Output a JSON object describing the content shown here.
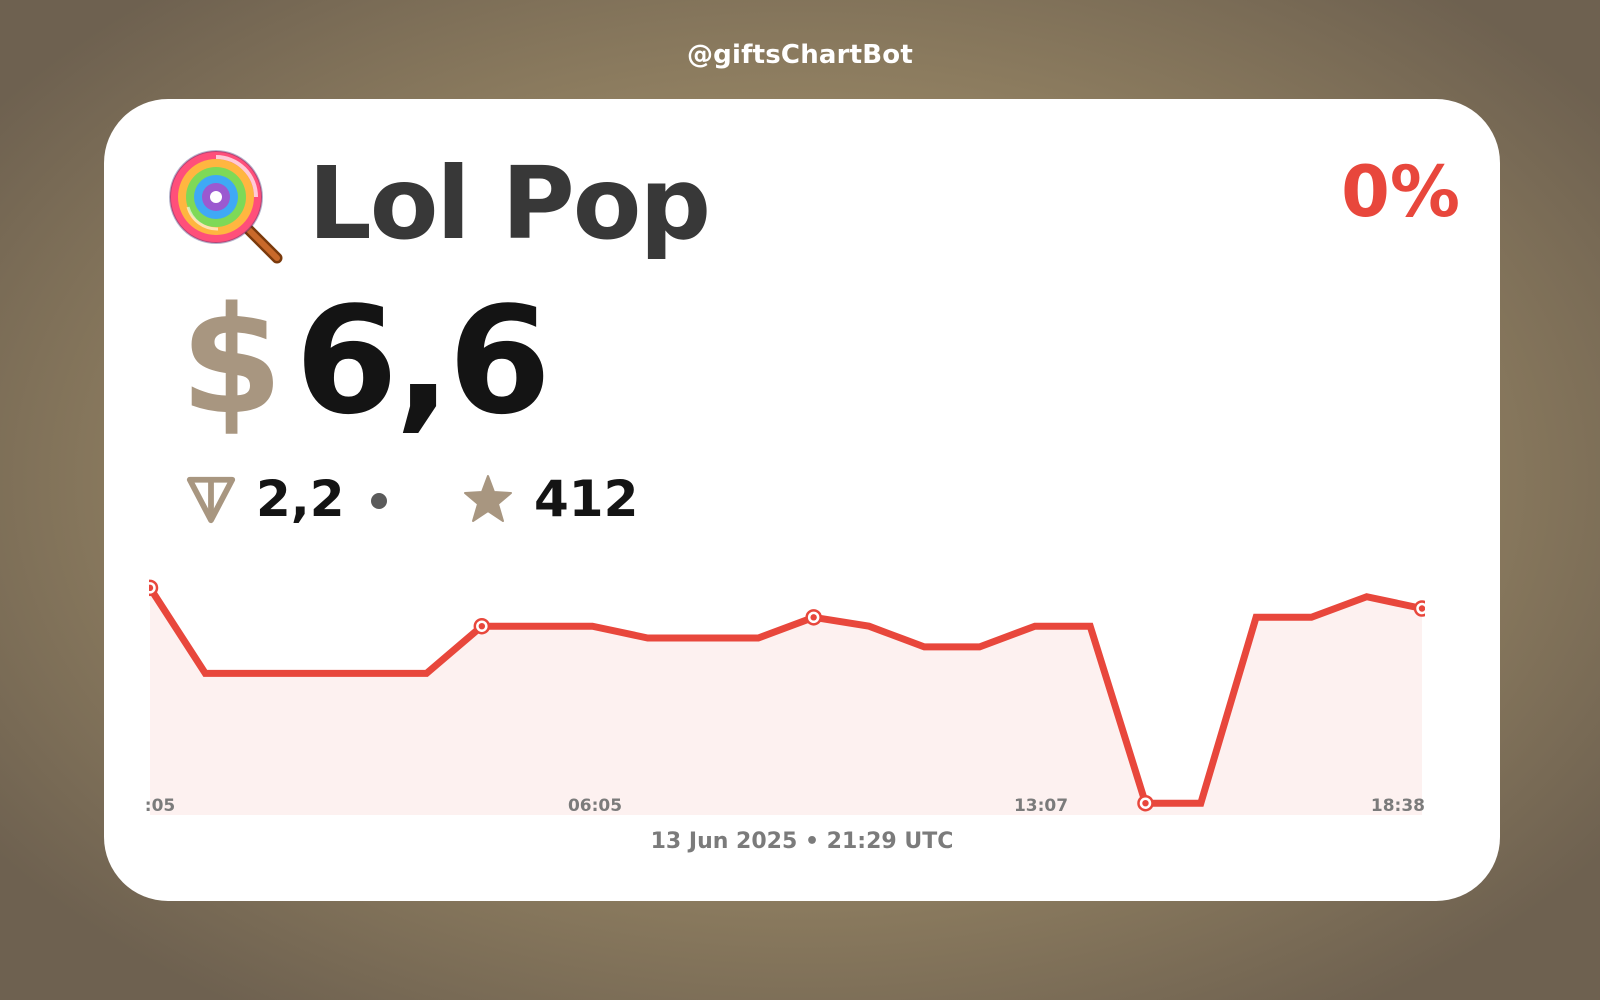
{
  "watermark": "@giftsChartBot",
  "gift": {
    "name": "Lol Pop",
    "icon": "lollipop-icon"
  },
  "change": {
    "label": "0%",
    "color": "#e8473c"
  },
  "price": {
    "currency": "$",
    "value": "6,6"
  },
  "ton": {
    "icon": "ton-icon",
    "value": "2,2"
  },
  "stars": {
    "icon": "star-icon",
    "value": "412"
  },
  "date": "13 Jun 2025 • 21:29 UTC",
  "colors": {
    "line": "#e8473c",
    "fill": "#fdf1f0",
    "accent": "#a89680",
    "text": "#141414"
  },
  "chart_data": {
    "type": "line",
    "x_tick_labels": [
      ":05",
      "06:05",
      "13:07",
      "18:38"
    ],
    "series": [
      {
        "values": [
          9.3,
          6.4,
          6.4,
          6.4,
          6.4,
          6.4,
          8.0,
          8.0,
          8.0,
          7.6,
          7.6,
          7.6,
          8.3,
          8.0,
          7.3,
          7.3,
          8.0,
          8.0,
          2.0,
          2.0,
          8.3,
          8.3,
          9.0,
          8.6
        ],
        "markers_at": [
          0,
          6,
          12,
          18,
          23
        ]
      }
    ],
    "ylim": [
      1.6,
      9.6
    ],
    "grid": false,
    "legend": false
  }
}
